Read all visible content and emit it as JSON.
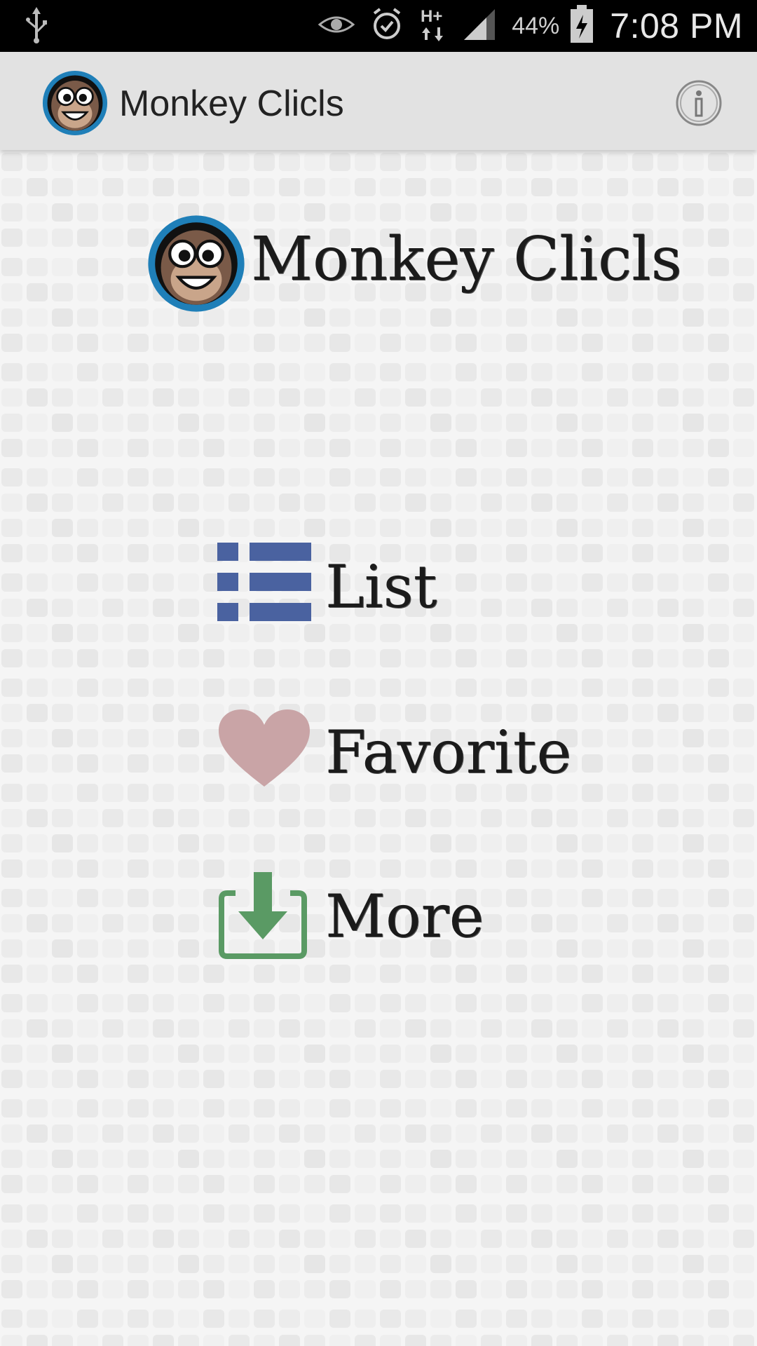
{
  "status_bar": {
    "icons": [
      "usb-icon",
      "eye-icon",
      "alarm-icon",
      "hplus-data-icon",
      "signal-icon",
      "battery-charging-icon"
    ],
    "battery_percent": "44%",
    "time": "7:08 PM"
  },
  "action_bar": {
    "title": "Monkey Clicls",
    "logo_icon": "monkey-face-icon",
    "info_icon": "info-icon"
  },
  "hero": {
    "title": "Monkey Clicls"
  },
  "menu": {
    "items": [
      {
        "label": "List",
        "icon": "list-icon",
        "color": "#4a62a0"
      },
      {
        "label": "Favorite",
        "icon": "heart-icon",
        "color": "#c9a4a6"
      },
      {
        "label": "More",
        "icon": "download-icon",
        "color": "#5a9a64"
      }
    ]
  },
  "colors": {
    "status_bar_bg": "#000000",
    "action_bar_bg": "#e2e2e2",
    "logo_ring": "#1f7fb8"
  }
}
